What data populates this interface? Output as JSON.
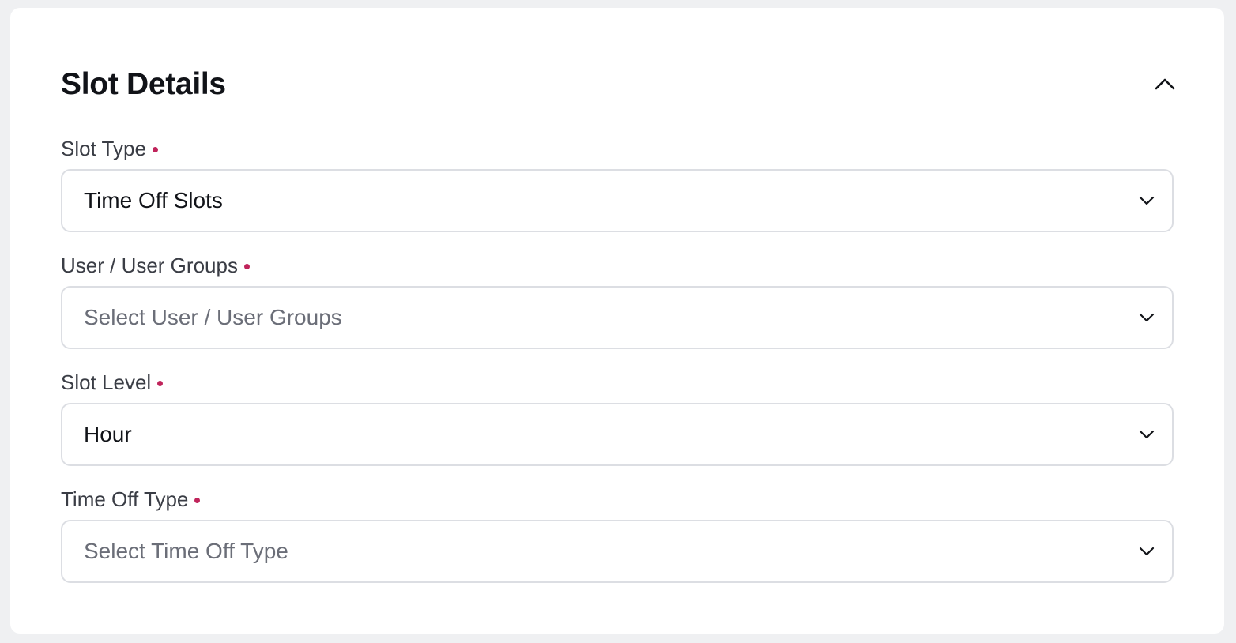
{
  "section": {
    "title": "Slot Details",
    "collapse_icon": "chevron-up-icon"
  },
  "fields": {
    "slot_type": {
      "label": "Slot Type",
      "required": true,
      "value": "Time Off Slots",
      "placeholder": ""
    },
    "user_groups": {
      "label": "User / User Groups",
      "required": true,
      "value": "",
      "placeholder": "Select User / User Groups"
    },
    "slot_level": {
      "label": "Slot Level",
      "required": true,
      "value": "Hour",
      "placeholder": ""
    },
    "time_off_type": {
      "label": "Time Off Type",
      "required": true,
      "value": "",
      "placeholder": "Select Time Off Type"
    }
  },
  "icons": {
    "dropdown": "chevron-down-icon"
  },
  "colors": {
    "required_dot": "#c0245b",
    "border": "#dcdee3",
    "background": "#eff0f2",
    "card": "#ffffff"
  }
}
